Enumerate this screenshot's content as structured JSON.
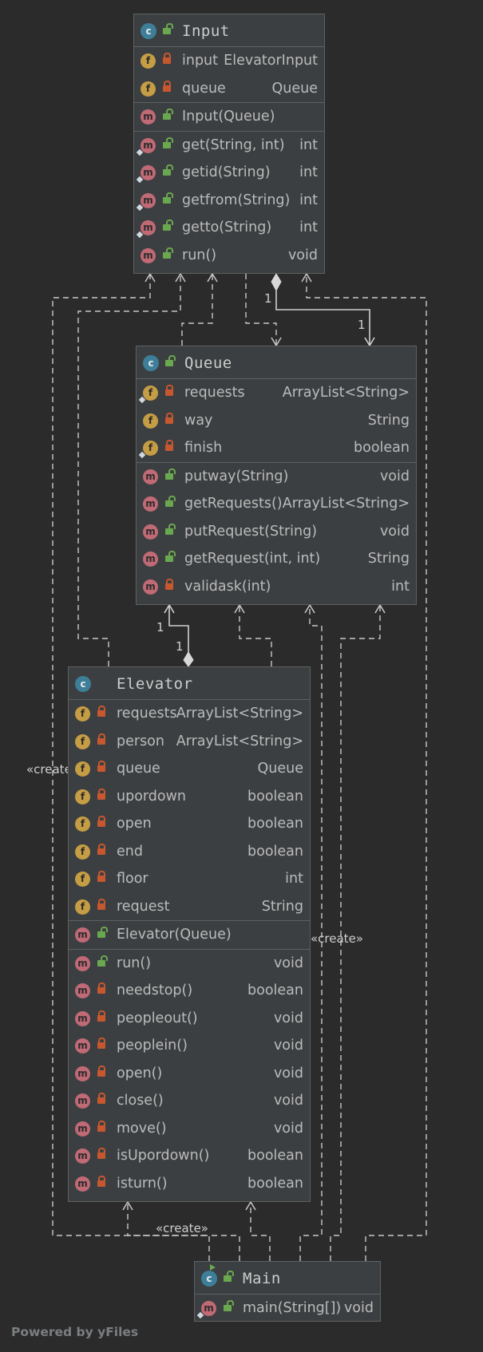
{
  "classes": {
    "input": {
      "name": "Input",
      "fields": [
        {
          "name": "input",
          "type": "ElevatorInput"
        },
        {
          "name": "queue",
          "type": "Queue"
        }
      ],
      "constructors": [
        {
          "name": "Input(Queue)",
          "type": ""
        }
      ],
      "methods": [
        {
          "name": "get(String, int)",
          "type": "int"
        },
        {
          "name": "getid(String)",
          "type": "int"
        },
        {
          "name": "getfrom(String)",
          "type": "int"
        },
        {
          "name": "getto(String)",
          "type": "int"
        },
        {
          "name": "run()",
          "type": "void"
        }
      ]
    },
    "queue": {
      "name": "Queue",
      "fields": [
        {
          "name": "requests",
          "type": "ArrayList<String>"
        },
        {
          "name": "way",
          "type": "String"
        },
        {
          "name": "finish",
          "type": "boolean"
        }
      ],
      "methods": [
        {
          "name": "putway(String)",
          "type": "void"
        },
        {
          "name": "getRequests()",
          "type": "ArrayList<String>"
        },
        {
          "name": "putRequest(String)",
          "type": "void"
        },
        {
          "name": "getRequest(int, int)",
          "type": "String"
        },
        {
          "name": "validask(int)",
          "type": "int"
        }
      ]
    },
    "elevator": {
      "name": "Elevator",
      "fields": [
        {
          "name": "requests",
          "type": "ArrayList<String>"
        },
        {
          "name": "person",
          "type": "ArrayList<String>"
        },
        {
          "name": "queue",
          "type": "Queue"
        },
        {
          "name": "upordown",
          "type": "boolean"
        },
        {
          "name": "open",
          "type": "boolean"
        },
        {
          "name": "end",
          "type": "boolean"
        },
        {
          "name": "floor",
          "type": "int"
        },
        {
          "name": "request",
          "type": "String"
        }
      ],
      "constructors": [
        {
          "name": "Elevator(Queue)",
          "type": ""
        }
      ],
      "methods": [
        {
          "name": "run()",
          "type": "void"
        },
        {
          "name": "needstop()",
          "type": "boolean"
        },
        {
          "name": "peopleout()",
          "type": "void"
        },
        {
          "name": "peoplein()",
          "type": "void"
        },
        {
          "name": "open()",
          "type": "void"
        },
        {
          "name": "close()",
          "type": "void"
        },
        {
          "name": "move()",
          "type": "void"
        },
        {
          "name": "isUpordown()",
          "type": "boolean"
        },
        {
          "name": "isturn()",
          "type": "boolean"
        }
      ]
    },
    "main": {
      "name": "Main",
      "methods": [
        {
          "name": "main(String[])",
          "type": "void"
        }
      ]
    }
  },
  "edge_labels": {
    "input_queue_mult_1": "1",
    "input_queue_mult_2": "1",
    "queue_elevator_mult_1": "1",
    "queue_elevator_mult_2": "1",
    "create_left": "«create»",
    "create_right": "«create»",
    "create_bottom": "«create»"
  },
  "footer": "Powered by yFiles",
  "colors": {
    "background": "#2b2b2b",
    "class_box": "#3c3f41",
    "class_icon": "#3d7f99",
    "field_icon": "#c59d44",
    "method_icon": "#c06a76",
    "public": "#6aa84f",
    "private": "#c6572f"
  }
}
